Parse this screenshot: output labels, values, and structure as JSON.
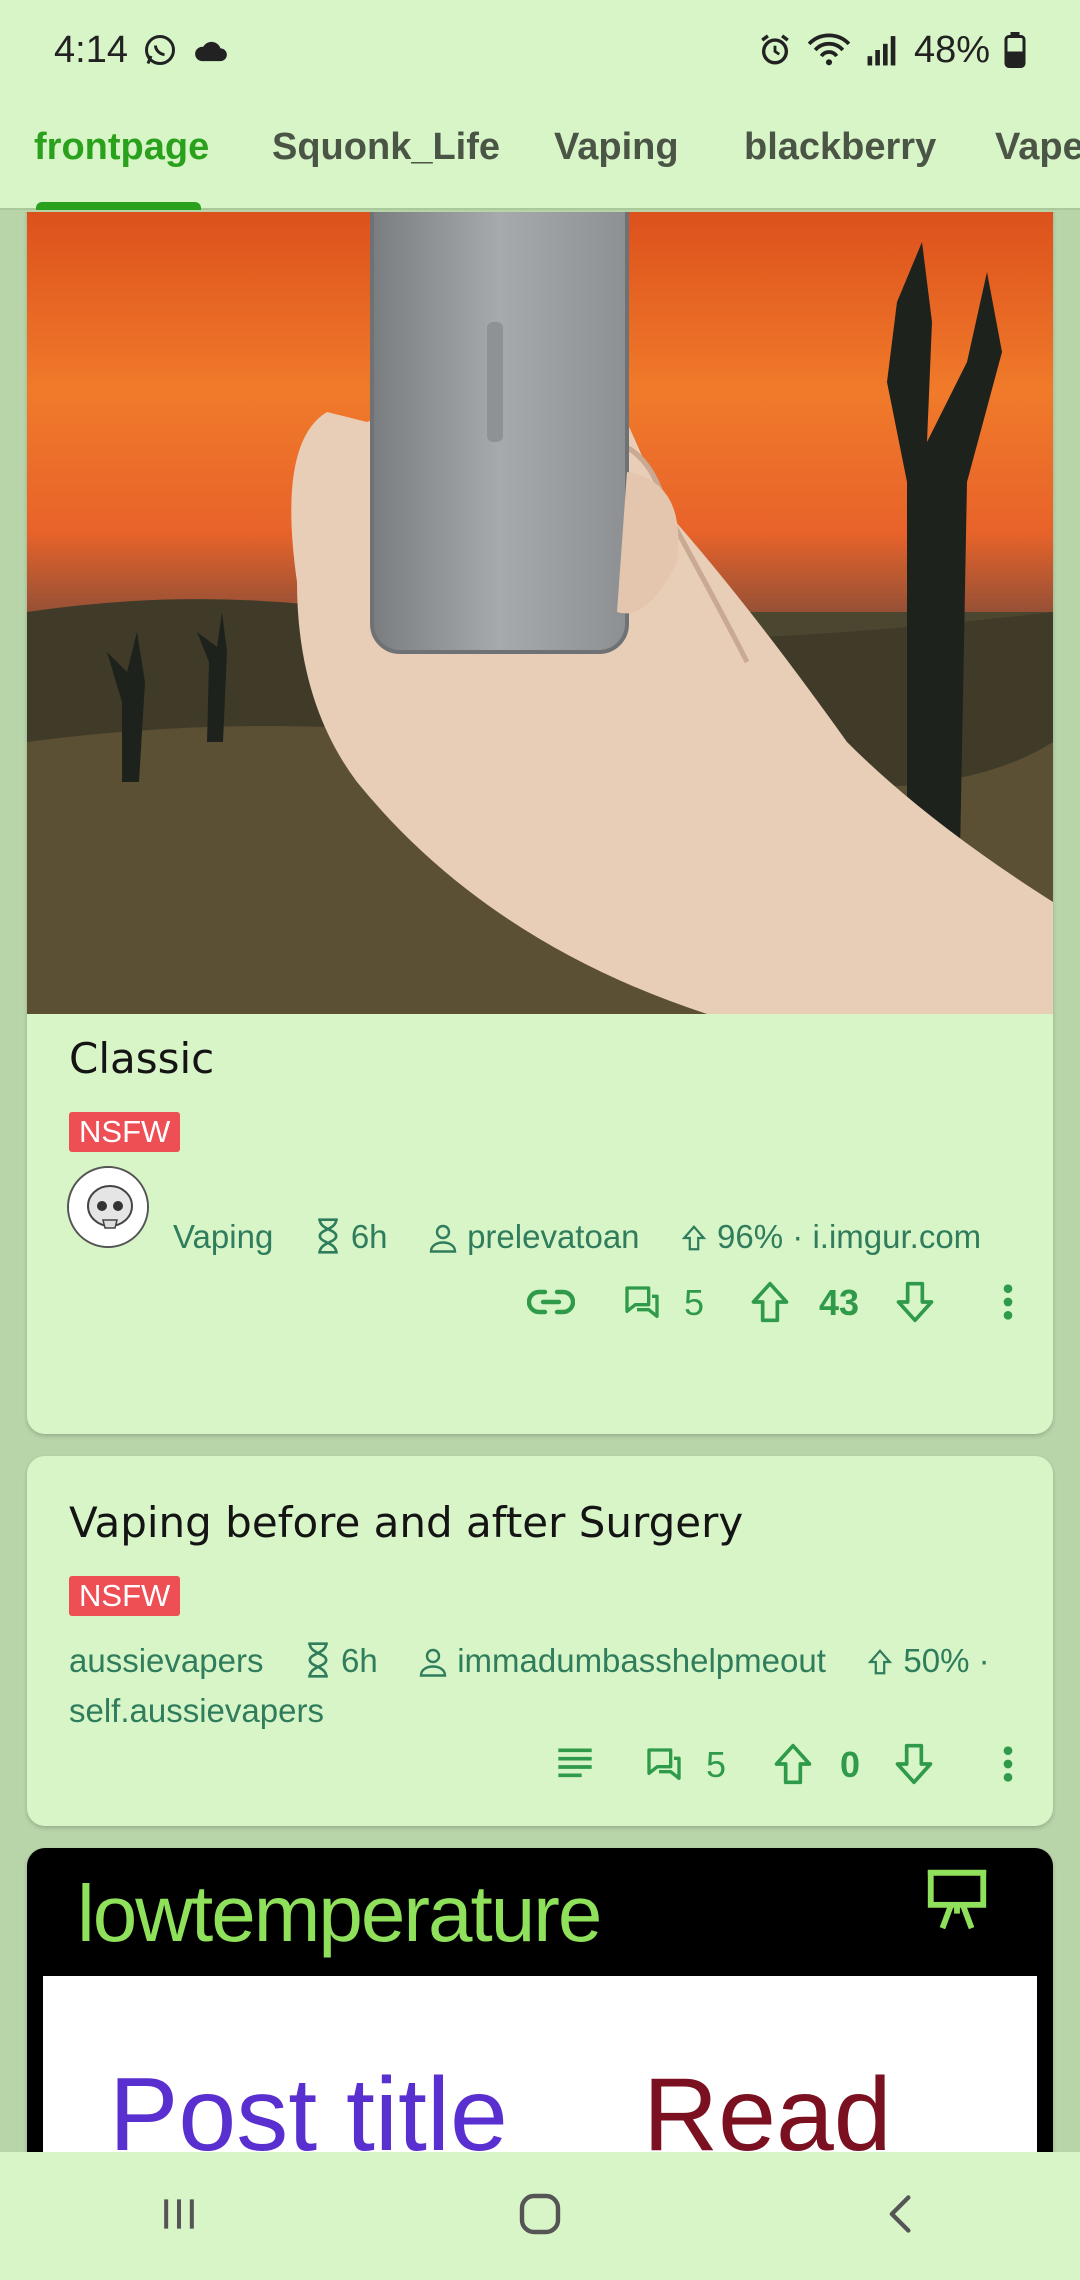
{
  "status": {
    "time": "4:14",
    "battery": "48%"
  },
  "tabs": [
    "frontpage",
    "Squonk_Life",
    "Vaping",
    "blackberry",
    "Vape"
  ],
  "posts": [
    {
      "title": "Classic",
      "nsfw": "NSFW",
      "subreddit": "Vaping",
      "age": "6h",
      "author": "prelevatoan",
      "upvote_ratio": "96%",
      "domain": "i.imgur.com",
      "comments": "5",
      "score": "43"
    },
    {
      "title": "Vaping before and after Surgery",
      "nsfw": "NSFW",
      "subreddit": "aussievapers",
      "age": "6h",
      "author": "immadumbasshelpmeout",
      "upvote_ratio": "50%",
      "domain": "self.aussievapers",
      "comments": "5",
      "score": "0"
    },
    {
      "image_text": "lowtemperature",
      "image_text2": "Post title",
      "image_text3": "Read"
    }
  ],
  "colors": {
    "accent": "#2aa11c",
    "surface": "#d8f5c8",
    "nsfw": "#ee4f55",
    "meta": "#2f7d5c"
  }
}
